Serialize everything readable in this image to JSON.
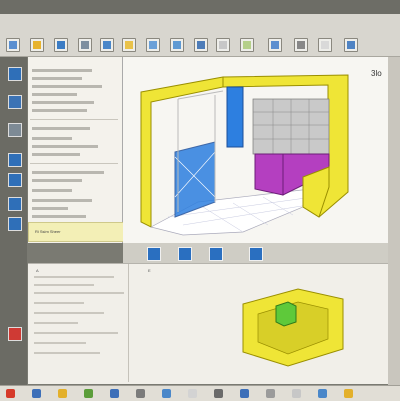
{
  "window": {
    "title": "",
    "view_label": "3lo"
  },
  "ribbon": {
    "buttons": [
      "#5a8fd0",
      "#e7b32d",
      "#3b7cc4",
      "#7e8f9f",
      "#4a87c9",
      "#e9c24a",
      "#6aa0d8",
      "#5f9ad3",
      "#4d7cb8",
      "#c7c7c7",
      "#b5d08a",
      "#5d8fcf",
      "#888",
      "#d9d9d9",
      "#4f83c3"
    ]
  },
  "left_panel": {
    "yellow_note": "Ri Ssim Sheer"
  },
  "lower_panel": {
    "header": "A",
    "title": "E"
  },
  "colors": {
    "cabinet_yellow": "#efe536",
    "panel_purple": "#b43fc0",
    "panel_blue": "#2d7fe0",
    "accent_green": "#5ec93a",
    "shelf_grey": "#c9c9c9"
  },
  "taskbar": {
    "icons": [
      "#d63a2a",
      "#3d6fb8",
      "#e3b02b",
      "#5b9d3a",
      "#3d6fb8",
      "#7b7b7b",
      "#4a87c9",
      "#d3d3d3",
      "#6a6a6a",
      "#3d6fb8",
      "#9b9b9b",
      "#c7c7c7",
      "#4a87c9",
      "#e3b02b"
    ]
  }
}
